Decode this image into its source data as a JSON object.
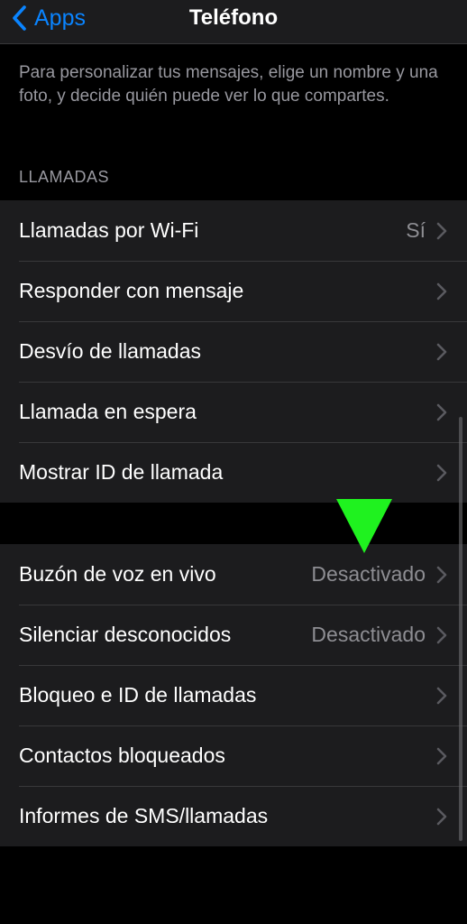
{
  "navbar": {
    "back_label": "Apps",
    "title": "Teléfono"
  },
  "description": "Para personalizar tus mensajes, elige un nombre y una foto, y decide quién puede ver lo que compartes.",
  "section_header": "LLAMADAS",
  "group1": [
    {
      "label": "Llamadas por Wi-Fi",
      "value": "Sí"
    },
    {
      "label": "Responder con mensaje",
      "value": ""
    },
    {
      "label": "Desvío de llamadas",
      "value": ""
    },
    {
      "label": "Llamada en espera",
      "value": ""
    },
    {
      "label": "Mostrar ID de llamada",
      "value": ""
    }
  ],
  "group2": [
    {
      "label": "Buzón de voz en vivo",
      "value": "Desactivado"
    },
    {
      "label": "Silenciar desconocidos",
      "value": "Desactivado"
    },
    {
      "label": "Bloqueo e ID de llamadas",
      "value": ""
    },
    {
      "label": "Contactos bloqueados",
      "value": ""
    },
    {
      "label": "Informes de SMS/llamadas",
      "value": ""
    }
  ],
  "colors": {
    "accent": "#0a84ff",
    "pointer": "#1ff21f",
    "background": "#000000",
    "cell": "#1c1c1e"
  },
  "icons": {
    "back": "chevron-left-icon",
    "row": "chevron-right-icon",
    "annotation": "down-arrow-pointer-icon"
  }
}
